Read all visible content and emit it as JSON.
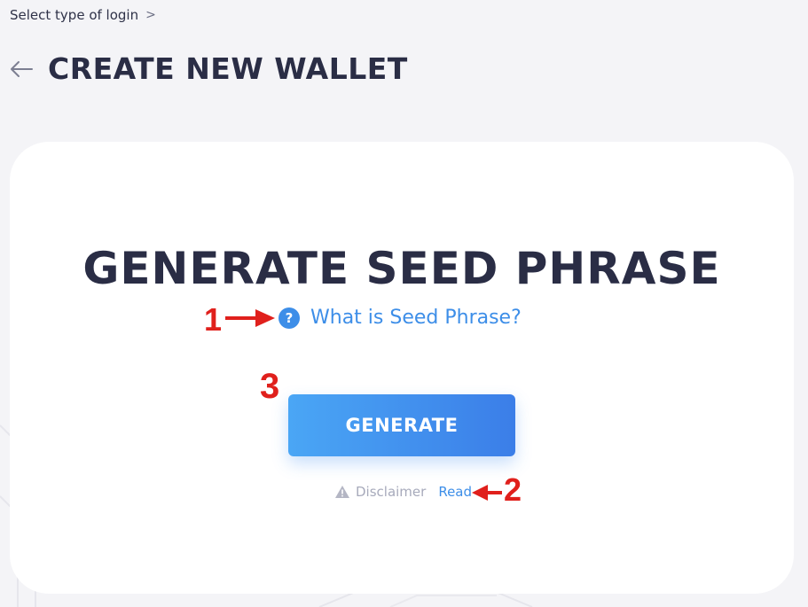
{
  "breadcrumb": {
    "label": "Select type of login",
    "chevron": ">"
  },
  "header": {
    "title": "CREATE NEW WALLET",
    "back_icon": "arrow-left-icon"
  },
  "card": {
    "title": "GENERATE SEED PHRASE",
    "help_icon_glyph": "?",
    "help_link": "What is Seed Phrase?",
    "generate_button": "GENERATE",
    "disclaimer_label": "Disclaimer",
    "read_link": "Read"
  },
  "annotations": {
    "one": "1",
    "two": "2",
    "three": "3"
  },
  "colors": {
    "accent": "#3d8ee8",
    "title_text": "#2a2d45",
    "annotation_red": "#e0201c",
    "background": "#f4f4f7"
  }
}
